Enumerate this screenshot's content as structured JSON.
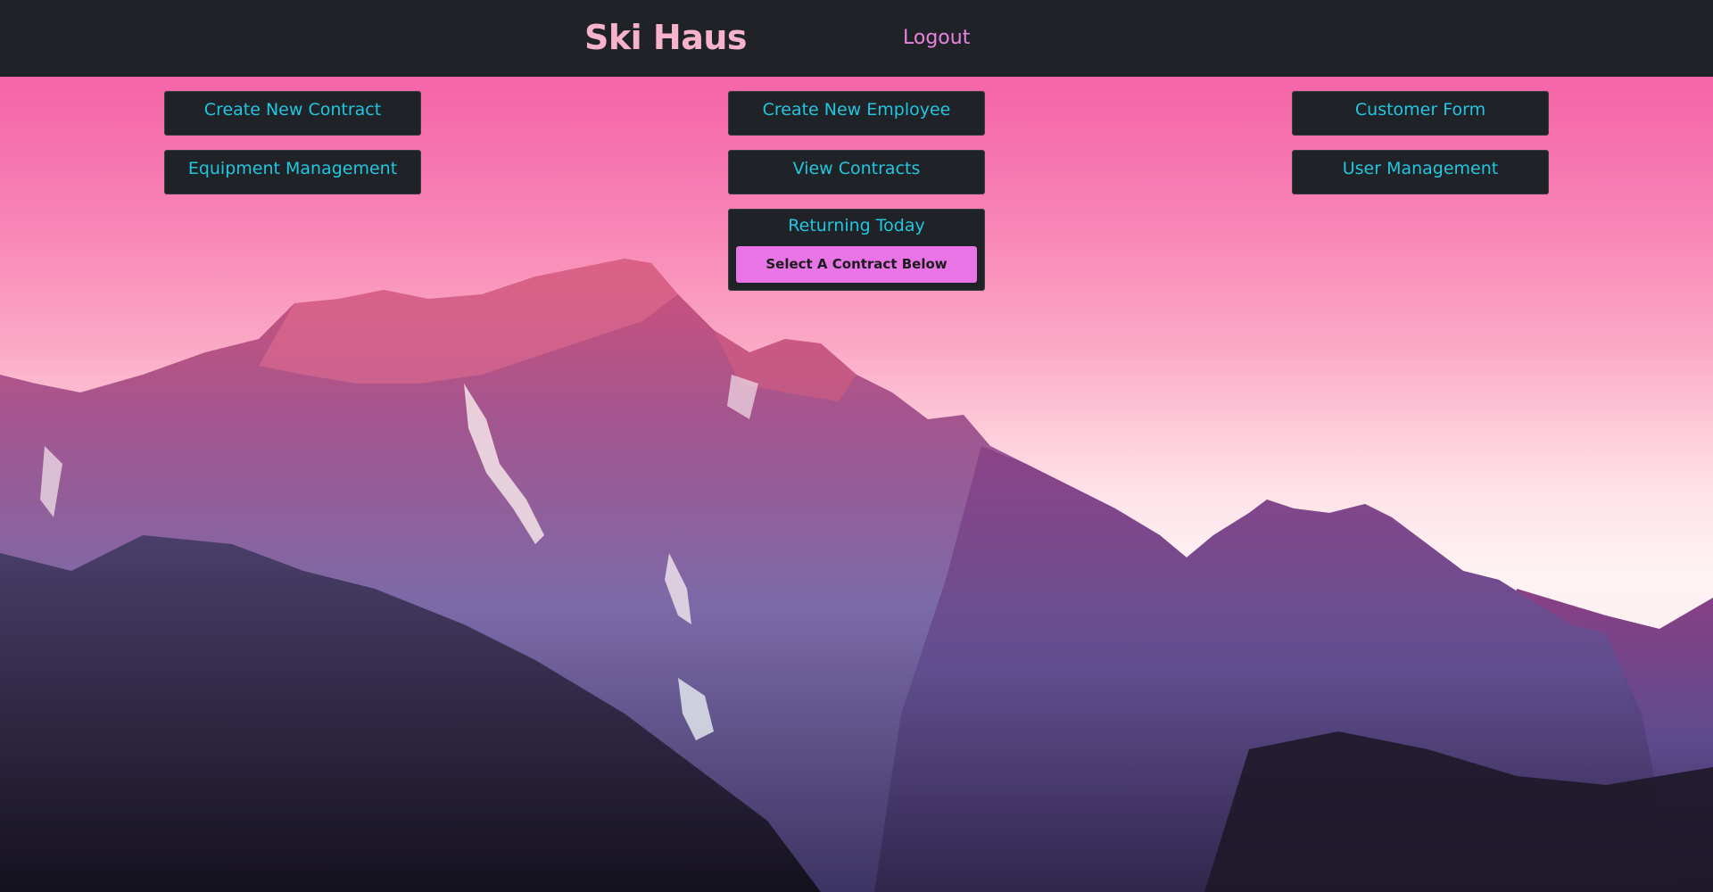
{
  "header": {
    "brand": "Ski Haus",
    "logout_label": "Logout"
  },
  "menu": {
    "create_contract": "Create New Contract",
    "equipment_management": "Equipment Management",
    "create_employee": "Create New Employee",
    "view_contracts": "View Contracts",
    "customer_form": "Customer Form",
    "user_management": "User Management"
  },
  "returning": {
    "title": "Returning Today",
    "select_label": "Select A Contract Below"
  },
  "colors": {
    "navbar_bg": "#1f2226",
    "brand": "#f7b3c9",
    "logout": "#e883de",
    "button_text": "#22c6e0",
    "select_button_bg": "#e874e6",
    "sky_top": "#f25aa6"
  },
  "background": {
    "description_icon": "mountain-landscape-image"
  }
}
